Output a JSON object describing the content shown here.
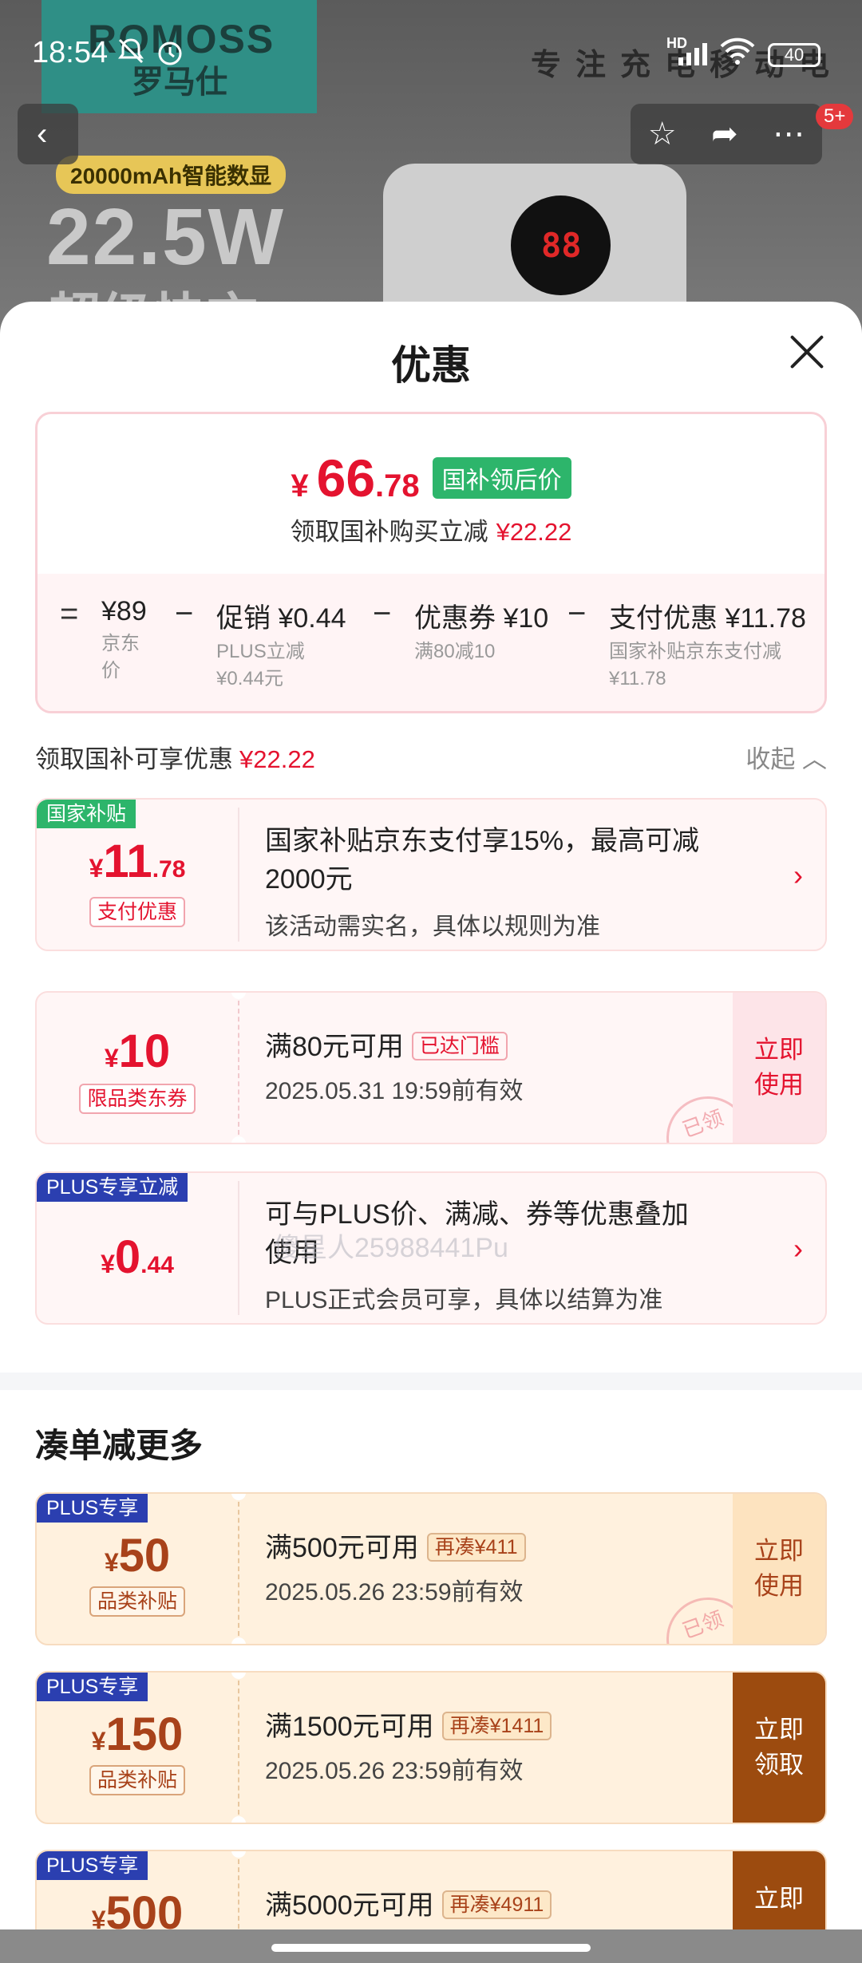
{
  "status_bar": {
    "time": "18:54",
    "battery": "40",
    "network": "HD"
  },
  "background": {
    "brand_en": "ROMOSS",
    "brand_cn": "罗马仕",
    "slogan": "专注充电移动电",
    "capacity_badge": "20000mAh智能数显",
    "power": "22.5W",
    "power_sub": "超级快充",
    "display_digits": "88"
  },
  "nav": {
    "message_badge": "5+"
  },
  "sheet": {
    "title": "优惠",
    "price": {
      "symbol": "¥",
      "integer": "66",
      "decimal": ".78",
      "tag": "国补领后价",
      "subtitle": "领取国补购买立减",
      "subtitle_amount": "¥22.22"
    },
    "breakdown": {
      "eq": "=",
      "op": "−",
      "items": [
        {
          "value": "¥89",
          "note": "京东\n价"
        },
        {
          "value": "促销 ¥0.44",
          "note": "PLUS立减\n¥0.44元"
        },
        {
          "value": "优惠券 ¥10",
          "note": "满80减10"
        },
        {
          "value": "支付优惠 ¥11.78",
          "note": "国家补贴京东支付减\n¥11.78"
        }
      ]
    },
    "entitled": {
      "label": "领取国补可享优惠",
      "amount": "¥22.22",
      "collapse": "收起"
    },
    "coupons": [
      {
        "tag": "国家补贴",
        "symbol": "¥",
        "int": "11",
        "dec": ".78",
        "sub": "支付优惠",
        "title": "国家补贴京东支付享15%，最高可减",
        "title2": "2000元",
        "desc": "该活动需实名，具体以规则为准"
      },
      {
        "symbol": "¥",
        "int": "10",
        "sub": "限品类东券",
        "title": "满80元可用",
        "flag": "已达门槛",
        "desc": "2025.05.31 19:59前有效",
        "action": "立即\n使用",
        "stamp": "已领"
      },
      {
        "tag": "PLUS专享立减",
        "symbol": "¥",
        "int": "0",
        "dec": ".44",
        "title": "可与PLUS价、满减、券等优惠叠加",
        "title2": "使用",
        "desc": "PLUS正式会员可享，具体以结算为准"
      }
    ],
    "more_title": "凑单减更多",
    "more_coupons": [
      {
        "tag": "PLUS专享",
        "symbol": "¥",
        "int": "50",
        "sub": "品类补贴",
        "title": "满500元可用",
        "flag": "再凑¥411",
        "desc": "2025.05.26 23:59前有效",
        "action": "立即\n使用",
        "stamp": "已领"
      },
      {
        "tag": "PLUS专享",
        "symbol": "¥",
        "int": "150",
        "sub": "品类补贴",
        "title": "满1500元可用",
        "flag": "再凑¥1411",
        "desc": "2025.05.26 23:59前有效",
        "action": "立即\n领取"
      },
      {
        "tag": "PLUS专享",
        "symbol": "¥",
        "int": "500",
        "title": "满5000元可用",
        "flag": "再凑¥4911",
        "action": "立即"
      }
    ],
    "watermark": "傻星人25988441Pu"
  },
  "colors": {
    "accent_red": "#e4132f",
    "green_tag": "#2db56b",
    "plus_blue": "#2b3fb0",
    "brown": "#9c4b0f"
  }
}
